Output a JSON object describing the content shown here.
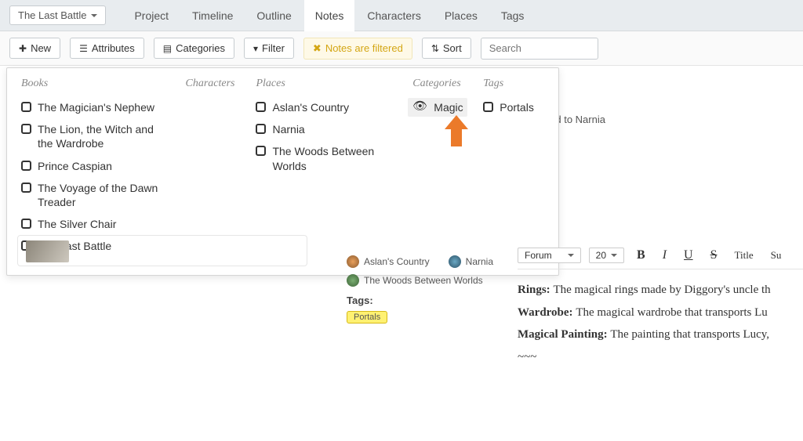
{
  "project": {
    "name": "The Last Battle"
  },
  "nav": {
    "project": "Project",
    "timeline": "Timeline",
    "outline": "Outline",
    "notes": "Notes",
    "characters": "Characters",
    "places": "Places",
    "tags": "Tags"
  },
  "toolbar": {
    "new": "New",
    "attributes": "Attributes",
    "categories": "Categories",
    "filter": "Filter",
    "filtered_msg": "Notes are filtered",
    "sort": "Sort",
    "search_placeholder": "Search"
  },
  "filter_dropdown": {
    "books_head": "Books",
    "books": [
      "The Magician's Nephew",
      "The Lion, the Witch and the Wardrobe",
      "Prince Caspian",
      "The Voyage of the Dawn Treader",
      "The Silver Chair",
      "The Last Battle"
    ],
    "chars_head": "Characters",
    "places_head": "Places",
    "places": [
      "Aslan's Country",
      "Narnia",
      "The Woods Between Worlds"
    ],
    "cats_head": "Categories",
    "cats": [
      "Magic"
    ],
    "tags_head": "Tags",
    "tags": [
      "Portals"
    ]
  },
  "breadcrumb_fragment": "hat Lead to Narnia",
  "mid": {
    "place1": "Aslan's Country",
    "place2": "Narnia",
    "place3": "The Woods Between Worlds",
    "tags_label": "Tags:",
    "tag1": "Portals"
  },
  "editor": {
    "font": "Forum",
    "size": "20",
    "title_btn": "Title",
    "su_btn": "Su",
    "lines": {
      "l1_b": "Rings: ",
      "l1_t": "The magical rings made by Diggory's uncle th",
      "l2_b": "Wardrobe: ",
      "l2_t": "The magical wardrobe that transports Lu",
      "l3_b": "Magical Painting: ",
      "l3_t": "The painting that transports Lucy, ",
      "l4": "~~~"
    }
  }
}
